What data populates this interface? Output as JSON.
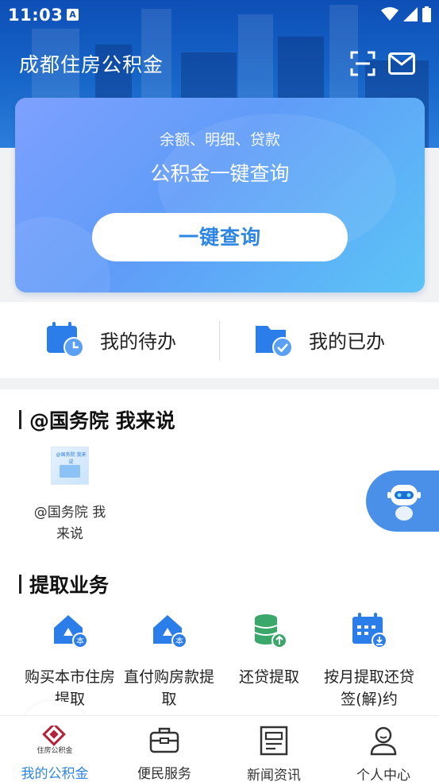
{
  "status_bar": {
    "time": "11:03",
    "notification_badge": "A"
  },
  "header": {
    "title": "成都住房公积金",
    "scan_icon": "scan-icon",
    "mail_icon": "mail-icon"
  },
  "hero": {
    "subtitle": "余额、明细、贷款",
    "title": "公积金一键查询",
    "button_label": "一键查询"
  },
  "todo": {
    "pending_label": "我的待办",
    "done_label": "我的已办"
  },
  "section_gov": {
    "title": "@国务院 我来说",
    "item_label_line1": "@国务院 我",
    "item_label_line2": "来说",
    "thumb_text": "@国务院 我来说"
  },
  "section_withdraw": {
    "title": "提取业务",
    "items": [
      {
        "line1": "购买本市住房",
        "line2": "提取",
        "icon": "house-badge-icon",
        "badge": "本"
      },
      {
        "line1": "直付购房款提",
        "line2": "取",
        "icon": "house-badge-icon",
        "badge": "本"
      },
      {
        "line1": "还贷提取",
        "line2": "",
        "icon": "coin-stack-icon"
      },
      {
        "line1": "按月提取还贷",
        "line2": "签(解)约",
        "icon": "calendar-icon"
      }
    ]
  },
  "tabbar": {
    "tabs": [
      {
        "label": "我的公积金",
        "icon": "gjj-logo-icon",
        "active": true,
        "logo_text": "住房公积金"
      },
      {
        "label": "便民服务",
        "icon": "briefcase-icon",
        "active": false
      },
      {
        "label": "新闻资讯",
        "icon": "news-icon",
        "active": false
      },
      {
        "label": "个人中心",
        "icon": "user-icon",
        "active": false
      }
    ]
  },
  "colors": {
    "accent": "#2e86e4",
    "header_bg": "#1766c9",
    "icon_blue": "#2b7de9",
    "icon_green": "#3aa868"
  }
}
